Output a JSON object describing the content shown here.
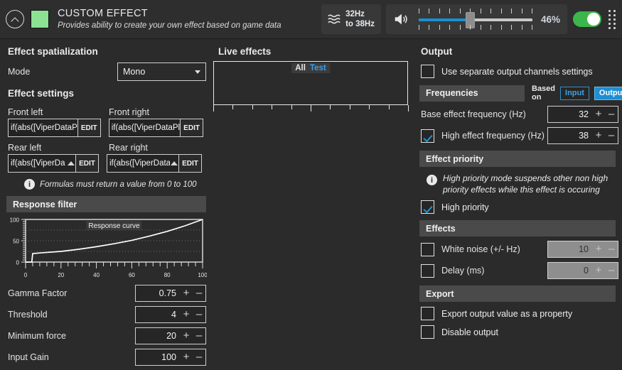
{
  "header": {
    "collapse_icon": "chevron-up-icon",
    "color_swatch": "#8ce292",
    "title": "CUSTOM EFFECT",
    "subtitle": "Provides ability to create your own effect based on game data",
    "frequency_icon": "waveform-icon",
    "frequency_line1": "32Hz",
    "frequency_line2": "to 38Hz",
    "volume_icon": "speaker-icon",
    "volume_percent": "46%",
    "volume_value": 46,
    "toggle_state": "on",
    "toggle_color": "#3cb54a",
    "drag_handle_icon": "drag-dots-icon",
    "slider_fill_color": "#1c8fd0"
  },
  "left": {
    "spatialization_title": "Effect spatialization",
    "mode_label": "Mode",
    "mode_value": "Mono",
    "mode_options": [
      "Mono"
    ],
    "settings_title": "Effect settings",
    "channels": [
      {
        "label": "Front left",
        "formula": "if(abs([ViperDataP",
        "edit_label": "EDIT",
        "overflow": false
      },
      {
        "label": "Front right",
        "formula": "if(abs([ViperDataPl",
        "edit_label": "EDIT",
        "overflow": false
      },
      {
        "label": "Rear left",
        "formula": "if(abs([ViperDa",
        "edit_label": "EDIT",
        "overflow": true
      },
      {
        "label": "Rear right",
        "formula": "if(abs([ViperData",
        "edit_label": "EDIT",
        "overflow": true
      }
    ],
    "formula_note": "Formulas must return a value from 0 to 100",
    "response_filter_title": "Response filter",
    "numeric": [
      {
        "label": "Gamma Factor",
        "value": "0.75",
        "plus": "+",
        "minus": "–",
        "disabled": false
      },
      {
        "label": "Threshold",
        "value": "4",
        "plus": "+",
        "minus": "–",
        "disabled": false
      },
      {
        "label": "Minimum force",
        "value": "20",
        "plus": "+",
        "minus": "–",
        "disabled": false
      },
      {
        "label": "Input Gain",
        "value": "100",
        "plus": "+",
        "minus": "–",
        "disabled": false
      }
    ]
  },
  "middle": {
    "live_effects_title": "Live effects",
    "legend_all": "All",
    "legend_test": "Test",
    "legend_test_color": "#3c9ee8"
  },
  "right": {
    "output_title": "Output",
    "separate_channels_label": "Use separate output channels settings",
    "separate_channels_checked": false,
    "frequencies_band": "Frequencies",
    "based_on_label": "Based on",
    "based_on_input": "Input",
    "based_on_output": "Output",
    "based_on_selected": "Output",
    "base_freq_label": "Base effect frequency (Hz)",
    "base_freq_value": "32",
    "high_freq_label": "High effect frequency (Hz)",
    "high_freq_value": "38",
    "high_freq_checked": true,
    "priority_band": "Effect priority",
    "priority_note": "High priority mode suspends other non high priority effects while this effect is occuring",
    "high_priority_label": "High priority",
    "high_priority_checked": true,
    "effects_band": "Effects",
    "white_noise_label": "White noise (+/- Hz)",
    "white_noise_value": "10",
    "white_noise_checked": false,
    "delay_label": "Delay (ms)",
    "delay_value": "0",
    "delay_checked": false,
    "export_band": "Export",
    "export_property_label": "Export output value as a property",
    "export_property_checked": false,
    "disable_output_label": "Disable output",
    "disable_output_checked": false
  },
  "chart_data": [
    {
      "type": "line",
      "title": "Response curve",
      "xlabel": "",
      "ylabel": "",
      "xlim": [
        0,
        100
      ],
      "ylim": [
        0,
        100
      ],
      "xticks": [
        0,
        20,
        40,
        60,
        80,
        100
      ],
      "yticks": [
        0,
        50,
        100
      ],
      "grid": true,
      "line_color": "#ffffff",
      "x": [
        0,
        3.5,
        4,
        10,
        20,
        30,
        40,
        50,
        60,
        70,
        80,
        90,
        100
      ],
      "y": [
        0,
        0,
        20,
        22,
        25,
        30,
        36,
        43,
        51,
        61,
        72,
        85,
        100
      ]
    },
    {
      "type": "line",
      "title": "Live effects",
      "series": [
        {
          "name": "All",
          "values": []
        },
        {
          "name": "Test",
          "values": []
        }
      ],
      "xlim": [
        0,
        100
      ],
      "ylim": [
        0,
        100
      ],
      "grid": false,
      "legend_position": "top-center"
    }
  ]
}
